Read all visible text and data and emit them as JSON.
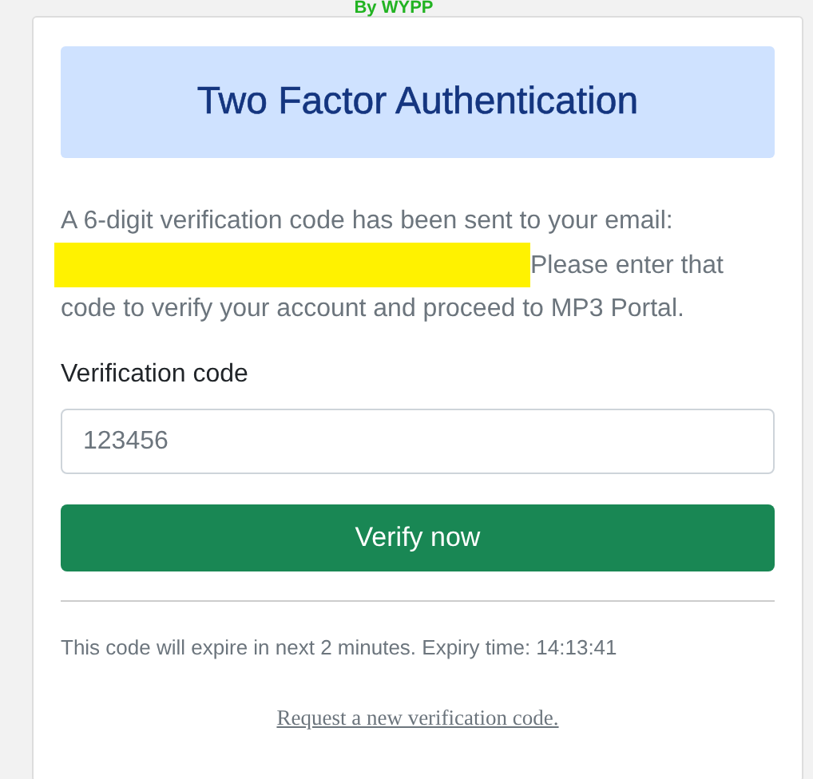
{
  "brand": "By WYPP",
  "header": {
    "title": "Two Factor Authentication"
  },
  "message": {
    "before": "A 6-digit verification code has been sent to your email:",
    "after": "Please enter that",
    "last": "code to verify your account and proceed to MP3 Portal."
  },
  "field": {
    "label": "Verification code",
    "placeholder": "123456"
  },
  "button": "Verify now",
  "expiry": "This code will expire in next 2 minutes. Expiry time: 14:13:41",
  "link": "Request a new verification code."
}
